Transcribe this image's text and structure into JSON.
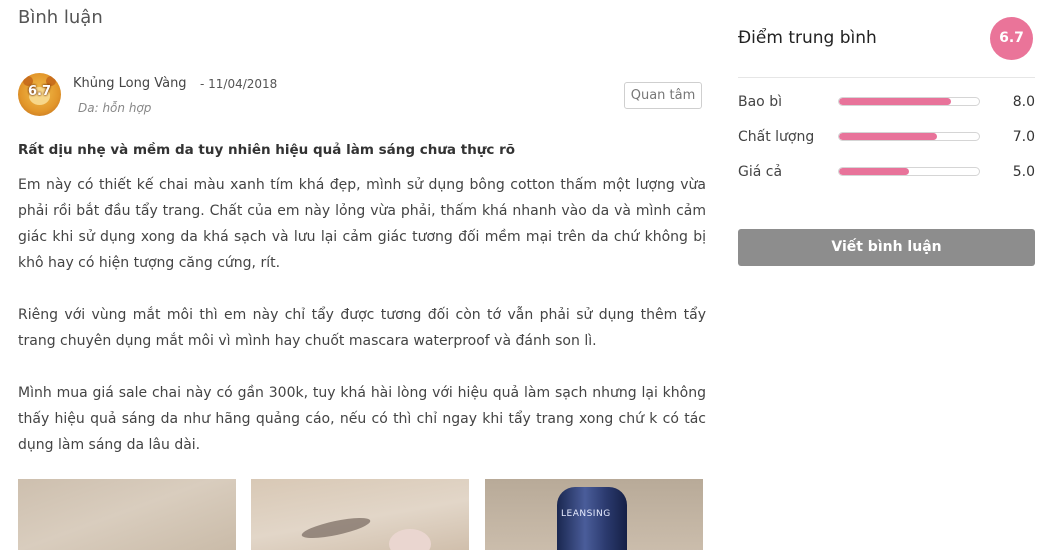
{
  "section": {
    "title": "Bình luận"
  },
  "review": {
    "author": "Khủng Long Vàng",
    "date": "- 11/04/2018",
    "skin_type": "Da: hỗn hợp",
    "avatar_score": "6.7",
    "follow_label": "Quan tâm",
    "title": "Rất dịu nhẹ và mềm da tuy nhiên hiệu quả làm sáng chưa thực rõ",
    "paragraphs": [
      "Em này có thiết kế chai màu xanh tím khá đẹp, mình sử dụng bông cotton thấm một lượng vừa phải rồi bắt đầu tẩy trang. Chất của em này lỏng vừa phải, thấm khá nhanh vào da và mình cảm giác khi sử dụng xong da khá sạch và lưu lại cảm giác tương đối mềm mại trên da chứ không bị khô hay có hiện tượng căng cứng, rít.",
      "Riêng với vùng mắt môi thì em này chỉ tẩy được tương đối còn tớ vẫn phải sử dụng thêm tẩy trang chuyên dụng mắt môi vì mình hay chuốt mascara waterproof và đánh son lì.",
      "Mình mua giá sale chai này có gần 300k, tuy khá hài lòng với hiệu quả làm sạch nhưng lại không thấy hiệu quả sáng da như hãng quảng cáo, nếu có thì chỉ ngay khi tẩy trang xong chứ k có tác dụng làm sáng da lâu dài."
    ],
    "photo_label": "LEANSING"
  },
  "rating": {
    "title": "Điểm trung bình",
    "average": "6.7",
    "accent_color": "#ea7499",
    "criteria": [
      {
        "label": "Bao bì",
        "value": "8.0",
        "fill": 0.8
      },
      {
        "label": "Chất lượng",
        "value": "7.0",
        "fill": 0.7
      },
      {
        "label": "Giá cả",
        "value": "5.0",
        "fill": 0.5
      }
    ],
    "write_label": "Viết bình luận"
  },
  "icons": {
    "avatar": "yellow-lion-avatar"
  }
}
